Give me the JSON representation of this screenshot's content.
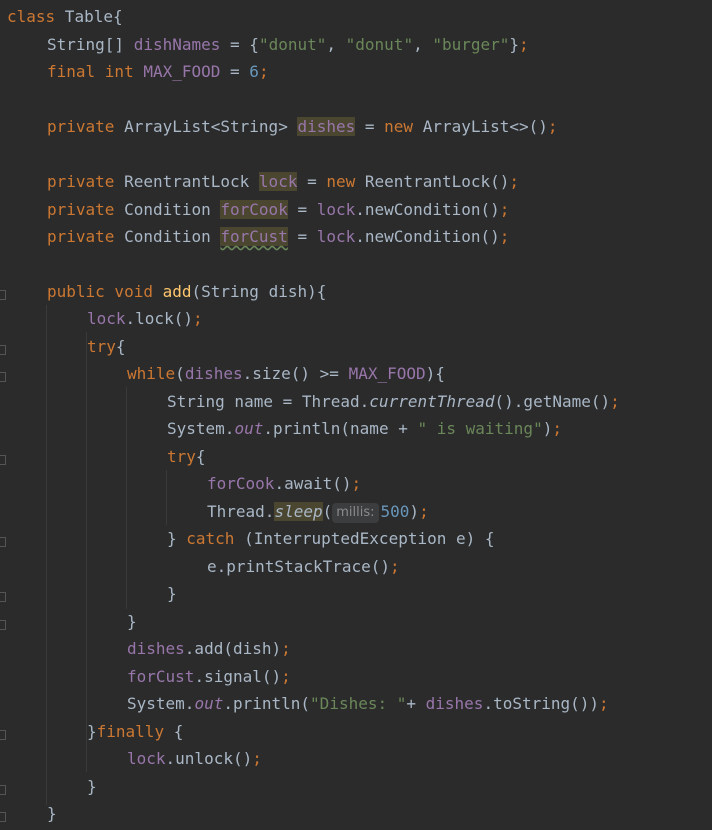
{
  "editor": {
    "theme": "Darcula",
    "colors": {
      "background": "#2b2b2b",
      "default_text": "#a9b7c6",
      "keyword": "#cc7832",
      "field": "#9876aa",
      "string": "#6a8759",
      "number": "#6897bb",
      "method_declaration": "#ffc66d",
      "usage_highlight": "#4a4630"
    },
    "tokens": {
      "kw_class": "class",
      "class_name": " Table{",
      "str_array_type": "String[] ",
      "dishNames": "dishNames",
      "eq1": " = {",
      "s_donut1": "\"donut\"",
      "comma1": ", ",
      "s_donut2": "\"donut\"",
      "comma2": ", ",
      "s_burger": "\"burger\"",
      "close1": "}",
      "semi1": ";",
      "kw_final_int": "final int ",
      "max_food": "MAX_FOOD",
      "eq2": " = ",
      "six": "6",
      "semi2": ";",
      "kw_private1": "private ",
      "arraylist_type": "ArrayList<String> ",
      "dishes_decl": "dishes",
      "eq3": " = ",
      "kw_new1": "new ",
      "arraylist_ctor": "ArrayList<>()",
      "semi3": ";",
      "kw_private2": "private ",
      "rlock_type": "ReentrantLock ",
      "lock_decl": "lock",
      "eq4": " = ",
      "kw_new2": "new ",
      "rlock_ctor": "ReentrantLock()",
      "semi4": ";",
      "kw_private3": "private ",
      "cond_type1": "Condition ",
      "forcook_decl": "forCook",
      "eq5": " = ",
      "lock_ref1": "lock",
      "newcond1": ".newCondition()",
      "semi5": ";",
      "kw_private4": "private ",
      "cond_type2": "Condition ",
      "forcust_decl": "forCust",
      "eq6": " = ",
      "lock_ref2": "lock",
      "newcond2": ".newCondition()",
      "semi6": ";",
      "kw_public_void": "public void ",
      "add_name": "add",
      "add_params": "(String dish){",
      "lock_ref3": "lock",
      "lock_call": ".lock()",
      "semi7": ";",
      "kw_try1": "try",
      "brace_try1": "{",
      "kw_while": "while",
      "paren_open": "(",
      "dishes_ref1": "dishes",
      "size_cmp": ".size() >= ",
      "max_food_ref": "MAX_FOOD",
      "while_close": "){",
      "string_name": "String name = Thread.",
      "current_thread": "currentThread",
      "get_name": "().getName()",
      "semi8": ";",
      "sys1": "System.",
      "out1": "out",
      "println1": ".println(name + ",
      "s_waiting": "\" is waiting\"",
      "close_paren1": ")",
      "semi9": ";",
      "kw_try2": "try",
      "brace_try2": "{",
      "forcook_ref": "forCook",
      "await_call": ".await()",
      "semi10": ";",
      "thread_prefix": "Thread.",
      "sleep_name": "sleep",
      "sleep_open": "(",
      "hint_millis": "millis:",
      "num_500": "500",
      "sleep_close": ")",
      "semi11": ";",
      "catch_brace": "} ",
      "kw_catch": "catch",
      "catch_rest": " (InterruptedException e) {",
      "print_stack": "e.printStackTrace()",
      "semi12": ";",
      "close_brace1": "}",
      "close_brace2": "}",
      "dishes_ref2": "dishes",
      "add_call": ".add(dish)",
      "semi13": ";",
      "forcust_ref": "forCust",
      "signal_call": ".signal()",
      "semi14": ";",
      "sys2": "System.",
      "out2": "out",
      "println2": ".println(",
      "s_dishes": "\"Dishes: \"",
      "plus": "+ ",
      "dishes_ref3": "dishes",
      "tostring_call": ".toString())",
      "semi15": ";",
      "finally_brace": "}",
      "kw_finally": "finally",
      "finally_open": " {",
      "lock_ref4": "lock",
      "unlock_call": ".unlock()",
      "semi16": ";",
      "close_brace3": "}",
      "close_brace4": "}"
    }
  }
}
